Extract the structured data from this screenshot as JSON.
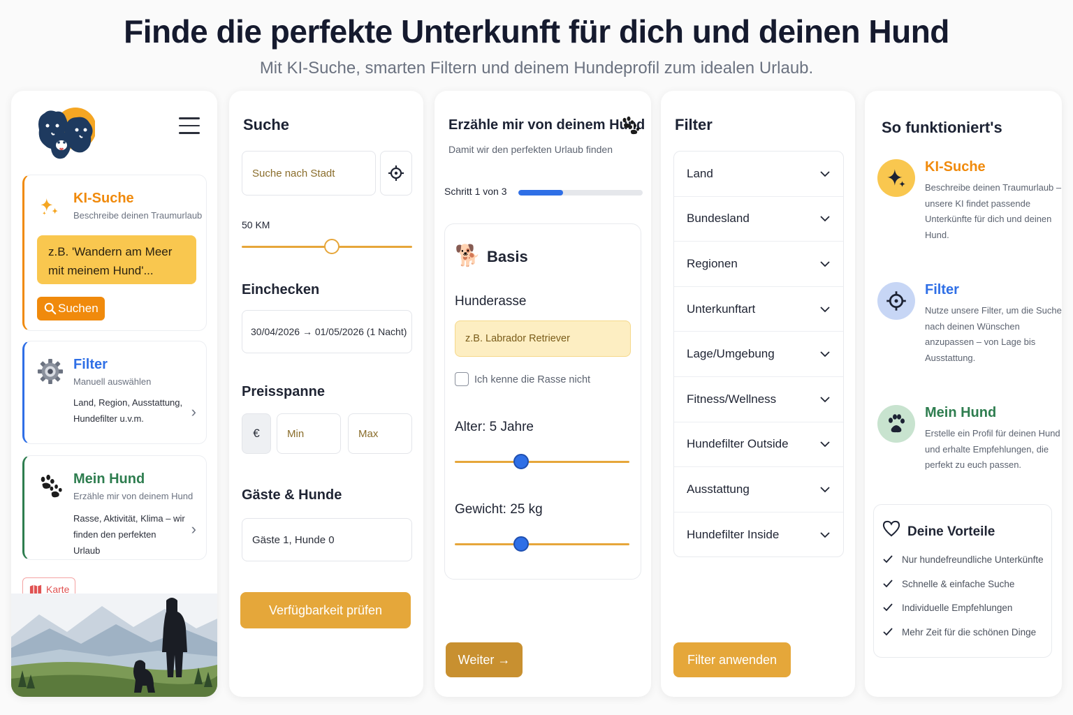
{
  "hero": {
    "title": "Finde die perfekte Unterkunft für dich und deinen Hund",
    "subtitle": "Mit KI-Suche, smarten Filtern und deinem Hundeprofil zum idealen Urlaub."
  },
  "sidebar": {
    "ki": {
      "title": "KI-Suche",
      "subtitle": "Beschreibe deinen Traumurlaub",
      "placeholder": "z.B. 'Wandern am Meer mit meinem Hund'...",
      "button": "Suchen"
    },
    "filter": {
      "title": "Filter",
      "subtitle": "Manuell auswählen",
      "desc": "Land, Region, Ausstattung, Hundefilter u.v.m."
    },
    "hund": {
      "title": "Mein Hund",
      "subtitle": "Erzähle mir von deinem Hund",
      "desc": "Rasse, Aktivität, Klima – wir finden den perfekten Urlaub"
    },
    "map_button": "Karte"
  },
  "suche": {
    "title": "Suche",
    "city_placeholder": "Suche nach Stadt",
    "radius_label": "50 KM",
    "radius_fraction": 0.53,
    "checkin_label": "Einchecken",
    "checkin_value": "30/04/2026 → 01/05/2026 (1 Nacht)",
    "price_label": "Preisspanne",
    "currency": "€",
    "min_placeholder": "Min",
    "max_placeholder": "Max",
    "guests_label": "Gäste & Hunde",
    "guests_value": "Gäste 1, Hunde 0",
    "submit": "Verfügbarkeit prüfen"
  },
  "dog": {
    "title": "Erzähle mir von deinem Hund",
    "subtitle": "Damit wir den perfekten Urlaub finden",
    "step_label": "Schritt 1 von 3",
    "progress": 0.36,
    "card_title": "Basis",
    "breed_label": "Hunderasse",
    "breed_placeholder": "z.B. Labrador Retriever",
    "unknown_breed": "Ich kenne die Rasse nicht",
    "age_label": "Alter: 5 Jahre",
    "age_fraction": 0.38,
    "weight_label": "Gewicht: 25 kg",
    "weight_fraction": 0.38,
    "next_button": "Weiter →"
  },
  "filters": {
    "title": "Filter",
    "items": [
      "Land",
      "Bundesland",
      "Regionen",
      "Unterkunftart",
      "Lage/Umgebung",
      "Fitness/Wellness",
      "Hundefilter Outside",
      "Ausstattung",
      "Hundefilter Inside"
    ],
    "apply": "Filter anwenden"
  },
  "howto": {
    "title": "So funktioniert's",
    "steps": [
      {
        "title": "KI-Suche",
        "desc": "Beschreibe deinen Traumurlaub – unsere KI findet passende Unterkünfte für dich und deinen Hund."
      },
      {
        "title": "Filter",
        "desc": "Nutze unsere Filter, um die Suche nach deinen Wünschen anzupassen – von Lage bis Ausstattung."
      },
      {
        "title": "Mein Hund",
        "desc": "Erstelle ein Profil für deinen Hund und erhalte Empfehlungen, die perfekt zu euch passen."
      }
    ],
    "benefits_title": "Deine Vorteile",
    "benefits": [
      "Nur hundefreundliche Unterkünfte",
      "Schnelle & einfache Suche",
      "Individuelle Empfehlungen",
      "Mehr Zeit für die schönen Dinge"
    ]
  },
  "colors": {
    "ki_accent": "#f08a0c",
    "filter_accent": "#2f6fe6",
    "hund_accent": "#2e7d4f",
    "gold_button": "#e5a73a",
    "slider_track": "#e6a63a",
    "slider_knob_blue": "#2f6fe6"
  },
  "icons": [
    "logo-dogs",
    "menu-icon",
    "sparkles-icon",
    "search-icon",
    "gear-icon",
    "paw-icon",
    "chevron-right-icon",
    "map-icon",
    "crosshair-icon",
    "dog-emoji-icon",
    "chevron-down-icon",
    "heart-icon",
    "check-icon"
  ]
}
